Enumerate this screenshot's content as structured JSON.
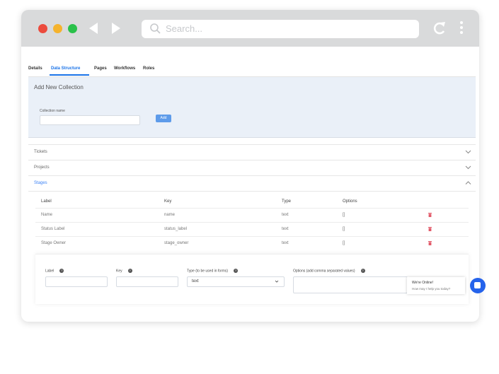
{
  "browser": {
    "search_placeholder": "Search...",
    "traffic_lights": [
      "#ec4b3d",
      "#f5b32d",
      "#2ac14a"
    ],
    "icons": [
      "back-icon",
      "forward-icon",
      "search-icon",
      "reload-icon",
      "kebab-menu-icon"
    ]
  },
  "tabs": [
    {
      "label": "Details",
      "active": false
    },
    {
      "label": "Data Structure",
      "active": true
    },
    {
      "label": "Pages",
      "active": false
    },
    {
      "label": "Workflows",
      "active": false
    },
    {
      "label": "Roles",
      "active": false
    }
  ],
  "add_collection": {
    "title": "Add New Collection",
    "name_label": "Collection name",
    "name_value": "",
    "add_label": "Add"
  },
  "collections": [
    {
      "label": "Tickets",
      "expanded": false
    },
    {
      "label": "Projects",
      "expanded": false
    },
    {
      "label": "Stages",
      "expanded": true
    }
  ],
  "fields_table": {
    "headers": [
      "Label",
      "Key",
      "Type",
      "Options"
    ],
    "rows": [
      {
        "label": "Name",
        "key": "name",
        "type": "text",
        "options": "[]"
      },
      {
        "label": "Status Label",
        "key": "status_label",
        "type": "text",
        "options": "[]"
      },
      {
        "label": "Stage Owner",
        "key": "stage_owner",
        "type": "text",
        "options": "[]"
      }
    ]
  },
  "new_field_form": {
    "label_label": "Label",
    "key_label": "Key",
    "type_label": "Type (to be used in forms)",
    "options_label": "Options (add comma separated values)",
    "type_value": "text",
    "help_glyph": "?"
  },
  "chat": {
    "line1": "We're Online!",
    "line2": "How may I help you today?"
  },
  "colors": {
    "accent": "#1a73e8",
    "add_button": "#5d9bea",
    "delete": "#e25b6a",
    "panel_bg": "#eaf0f8"
  }
}
